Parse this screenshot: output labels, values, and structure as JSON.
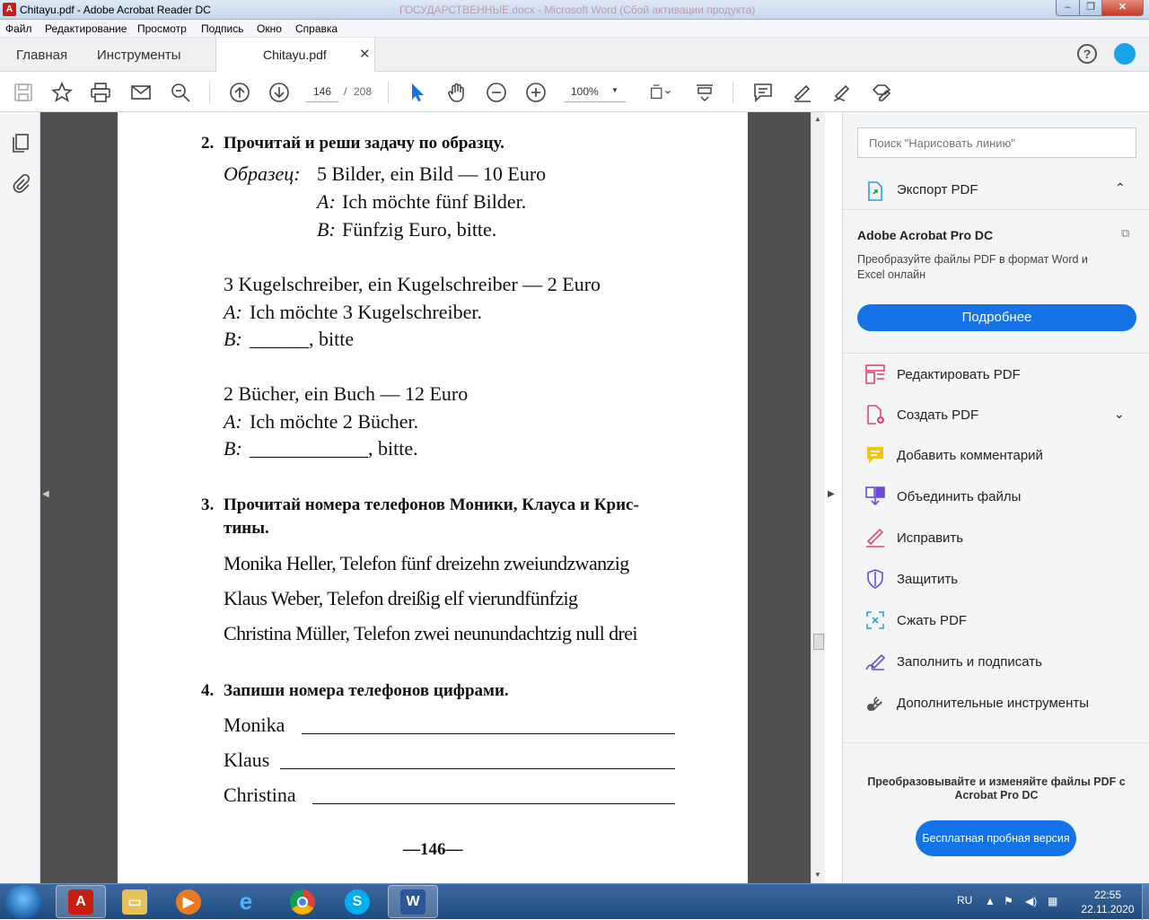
{
  "window": {
    "title": "Chitayu.pdf - Adobe Acrobat Reader DC",
    "background_title": "ГОСУДАРСТВЕННЫЕ.docx - Microsoft Word (Сбой активации продукта)",
    "min": "–",
    "max": "❐",
    "close": "✕"
  },
  "menu": [
    "Файл",
    "Редактирование",
    "Просмотр",
    "Подпись",
    "Окно",
    "Справка"
  ],
  "tabs": {
    "home": "Главная",
    "tools": "Инструменты",
    "doc": "Chitayu.pdf",
    "close": "✕",
    "help": "?"
  },
  "toolbar": {
    "page_current": "146",
    "page_sep": "/",
    "page_total": "208",
    "zoom": "100%",
    "zoom_caret": "▼"
  },
  "document": {
    "task2_num": "2.",
    "task2_title": "Прочитай и реши задачу по образцу.",
    "sample_label": "Образец:",
    "sample_line": "5 Bilder, ein Bild — 10 Euro",
    "a_label": "A:",
    "b_label": "B:",
    "sample_a": "Ich möchte fünf Bilder.",
    "sample_b": "Fünfzig Euro, bitte.",
    "ex1_line": "3 Kugelschreiber, ein Kugelschreiber — 2 Euro",
    "ex1_a": "Ich möchte 3 Kugelschreiber.",
    "ex1_b": "______, bitte",
    "ex2_line": "2 Bücher, ein Buch — 12 Euro",
    "ex2_a": "Ich möchte 2 Bücher.",
    "ex2_b": "____________, bitte.",
    "task3_num": "3.",
    "task3_title_1": "Прочитай номера телефонов Моники, Клауса и Крис-",
    "task3_title_2": "тины.",
    "phone1": "Monika Heller, Telefon fünf dreizehn zweiundzwanzig",
    "phone2": "Klaus Weber, Telefon dreißig elf vierundfünfzig",
    "phone3": "Christina Müller, Telefon zwei neunundachtzig null drei",
    "task4_num": "4.",
    "task4_title": "Запиши номера телефонов цифрами.",
    "write1": "Monika",
    "write2": "Klaus",
    "write3": "Christina",
    "page_number": "—146—"
  },
  "nav": {
    "collapse_left": "◀",
    "collapse_right": "▶",
    "scroll_up": "▲",
    "scroll_down": "▼"
  },
  "right_panel": {
    "search_placeholder": "Поиск \"Нарисовать линию\"",
    "export": "Экспорт PDF",
    "export_chevron": "⌃",
    "pro_title": "Adobe Acrobat Pro DC",
    "pro_desc": "Преобразуйте файлы PDF в формат Word и Excel онлайн",
    "more_button": "Подробнее",
    "tools": [
      {
        "label": "Редактировать PDF",
        "icon": "edit-pdf-icon",
        "color": "#e0457b"
      },
      {
        "label": "Создать PDF",
        "icon": "create-pdf-icon",
        "color": "#e0457b"
      },
      {
        "label": "Добавить комментарий",
        "icon": "comment-icon",
        "color": "#f0c419"
      },
      {
        "label": "Объединить файлы",
        "icon": "combine-files-icon",
        "color": "#6c4ad6"
      },
      {
        "label": "Исправить",
        "icon": "fill-sign-pen-icon",
        "color": "#e0457b"
      },
      {
        "label": "Защитить",
        "icon": "shield-icon",
        "color": "#6c4ad6"
      },
      {
        "label": "Сжать PDF",
        "icon": "compress-pdf-icon",
        "color": "#2b9fd6"
      },
      {
        "label": "Заполнить и подписать",
        "icon": "sign-icon",
        "color": "#6c4ad6"
      },
      {
        "label": "Дополнительные инструменты",
        "icon": "wrench-icon",
        "color": "#555555"
      }
    ],
    "create_chevron": "⌄",
    "promo": "Преобразовывайте и изменяйте файлы PDF с Acrobat Pro DC",
    "trial_button": "Бесплатная пробная версия"
  },
  "taskbar": {
    "lang": "RU",
    "time": "22:55",
    "date": "22.11.2020"
  },
  "colors": {
    "accent": "#1473e6",
    "acrobat_red": "#c81d11"
  }
}
